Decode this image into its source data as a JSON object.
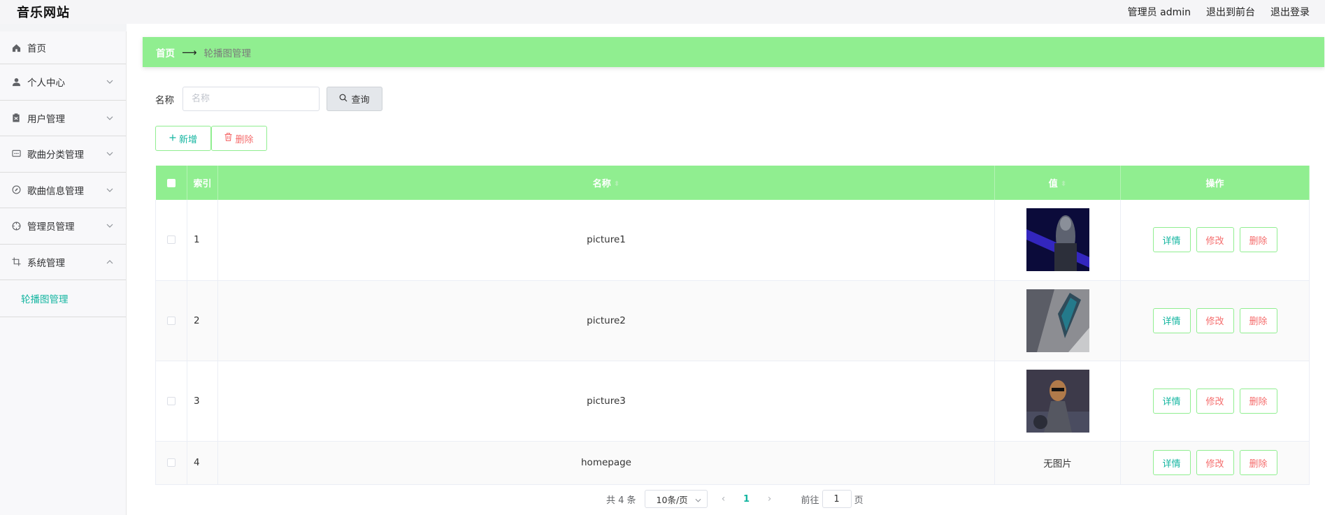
{
  "header": {
    "brand": "音乐网站",
    "user": "管理员 admin",
    "to_front": "退出到前台",
    "logout": "退出登录"
  },
  "sidebar": {
    "items": [
      {
        "label": "首页",
        "icon": "home-icon"
      },
      {
        "label": "个人中心",
        "icon": "user-icon"
      },
      {
        "label": "用户管理",
        "icon": "clipboard-icon"
      },
      {
        "label": "歌曲分类管理",
        "icon": "chat-icon"
      },
      {
        "label": "歌曲信息管理",
        "icon": "compass-icon"
      },
      {
        "label": "管理员管理",
        "icon": "target-icon"
      },
      {
        "label": "系统管理",
        "icon": "crop-icon"
      }
    ],
    "sub_active": "轮播图管理"
  },
  "breadcrumb": {
    "home": "首页",
    "current": "轮播图管理"
  },
  "search": {
    "label": "名称",
    "placeholder": "名称",
    "button": "查询"
  },
  "actions": {
    "add": "新增",
    "delete": "删除"
  },
  "table": {
    "headers": {
      "index": "索引",
      "name": "名称",
      "value": "值",
      "ops": "操作"
    },
    "rows": [
      {
        "index": "1",
        "name": "picture1",
        "value": ""
      },
      {
        "index": "2",
        "name": "picture2",
        "value": ""
      },
      {
        "index": "3",
        "name": "picture3",
        "value": ""
      },
      {
        "index": "4",
        "name": "homepage",
        "value": "无图片"
      }
    ],
    "ops": {
      "detail": "详情",
      "edit": "修改",
      "delete": "删除"
    }
  },
  "pagination": {
    "total": "共 4 条",
    "page_size": "10条/页",
    "current_page": "1",
    "goto_label": "前往",
    "goto_value": "1",
    "goto_suffix": "页"
  },
  "colors": {
    "accent_green": "#90ee90",
    "teal": "#13b5a0",
    "danger": "#f56c6c"
  }
}
